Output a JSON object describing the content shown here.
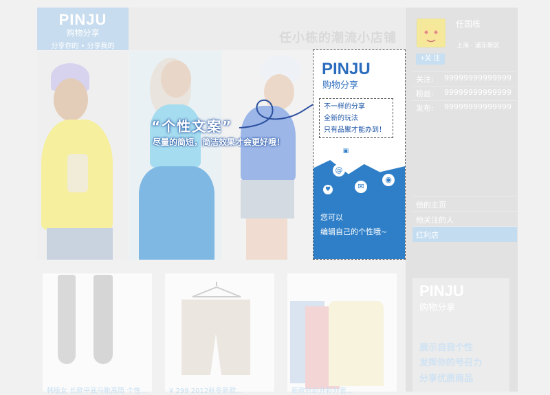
{
  "header": {
    "logo_text": "PINJU",
    "logo_sub": "购物分享",
    "logo_tagline": "分享你的 • 分享我的",
    "shop_title": "任小栋的潮流小店铺"
  },
  "banner": {
    "caption_title": "“个性文案”",
    "caption_sub": "尽量的简短，简洁效果才会更好哦！"
  },
  "feature_card": {
    "logo": "PINJU",
    "subtitle": "购物分享",
    "lines": [
      "不一样的分享",
      "全新的玩法",
      "只有品聚才能办到！"
    ],
    "footer_1": "您可以",
    "footer_2": "编辑自己的个性哦~",
    "icons": [
      "at-icon",
      "comment-icon",
      "camera-icon",
      "heart-icon",
      "shopping-bag-icon"
    ]
  },
  "profile": {
    "name": "任国栋",
    "location": "上海 · 浦东新区",
    "follow_label": "+关 注",
    "stats": [
      {
        "label": "关注:",
        "value": "99999999999999"
      },
      {
        "label": "粉丝:",
        "value": "99999999999999"
      },
      {
        "label": "发布:",
        "value": "99999999999999"
      }
    ]
  },
  "nav": {
    "items": [
      "他的主页",
      "他关注的人",
      "红利店"
    ],
    "active_index": 2
  },
  "side_promo": {
    "logo": "PINJU",
    "subtitle": "购物分享",
    "lines": [
      "展示自我个性",
      "发挥你的号召力",
      "分享优质商品"
    ]
  },
  "products": [
    {
      "caption": "韩版女 长款平底马靴高筒 个性..."
    },
    {
      "caption": "¥ 299  2012秋冬新款..."
    },
    {
      "caption": "新款针织开衫外套..."
    }
  ],
  "colors": {
    "brand_blue": "#2f7fc8",
    "light_blue": "#c7dcee",
    "sidebar_gray": "#e2e2e2"
  }
}
